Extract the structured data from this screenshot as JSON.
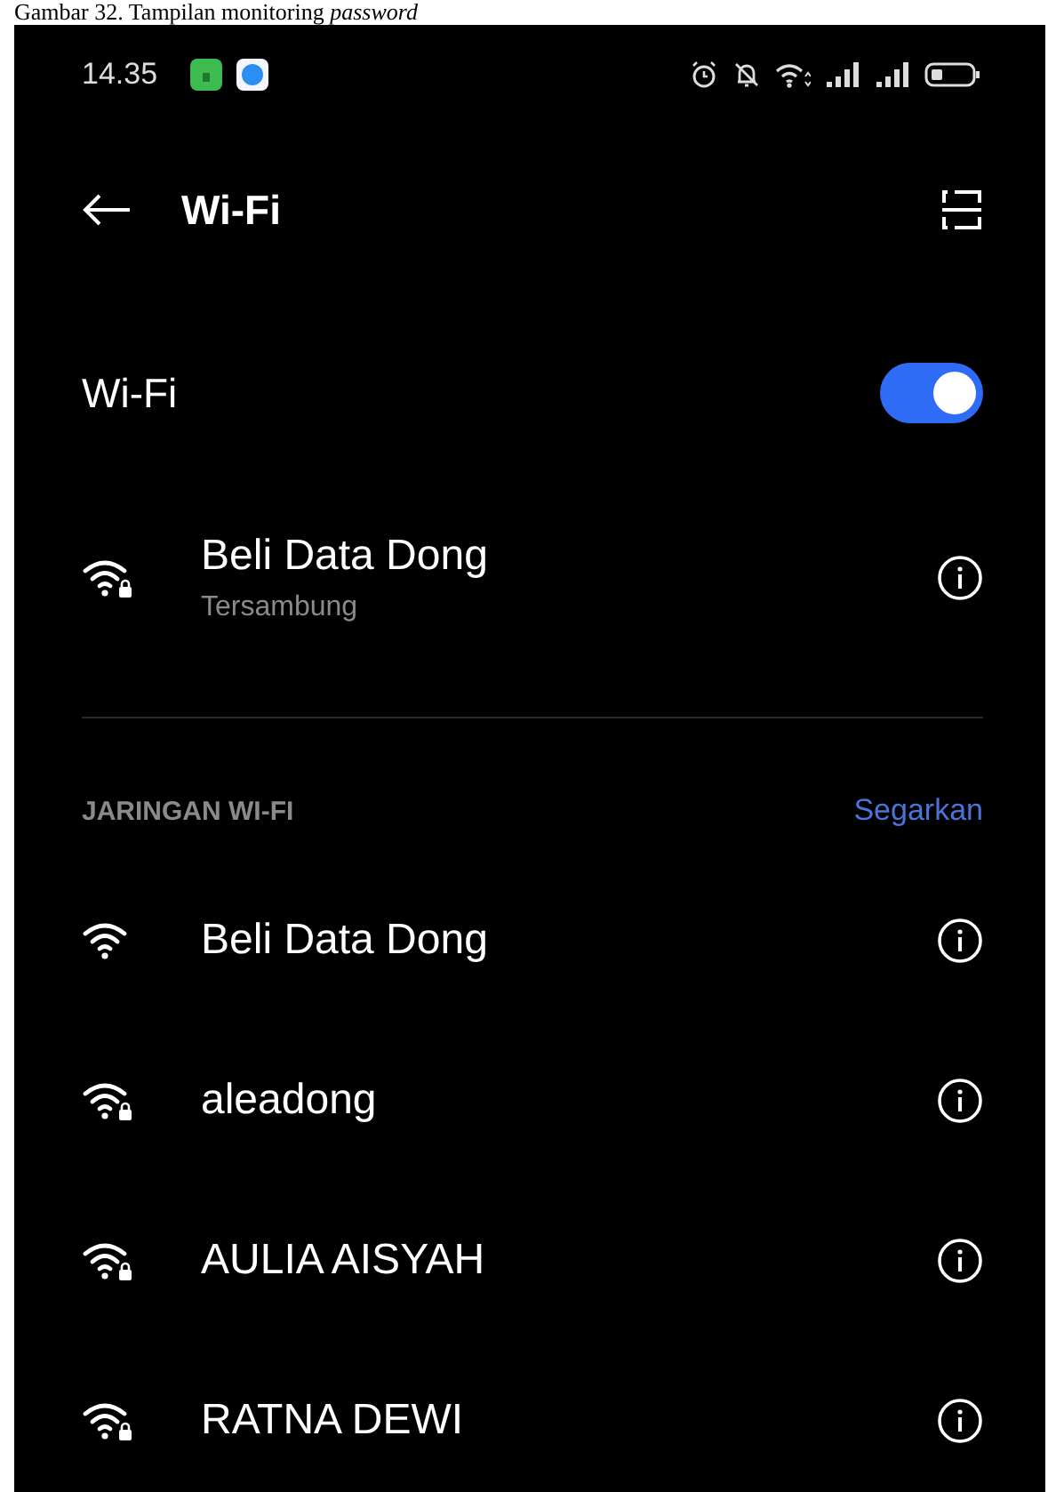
{
  "caption": "Gambar 32. Tampilan monitoring *password*",
  "status_bar": {
    "time": "14.35"
  },
  "header": {
    "title": "Wi-Fi"
  },
  "wifi_toggle": {
    "label": "Wi-Fi",
    "on": true
  },
  "connected": {
    "name": "Beli Data Dong",
    "status": "Tersambung",
    "secured": true
  },
  "section": {
    "title": "JARINGAN WI-FI",
    "action": "Segarkan"
  },
  "networks": [
    {
      "name": "Beli Data Dong",
      "secured": false
    },
    {
      "name": "aleadong",
      "secured": true
    },
    {
      "name": "AULIA AISYAH",
      "secured": true
    },
    {
      "name": "RATNA DEWI",
      "secured": true
    }
  ]
}
